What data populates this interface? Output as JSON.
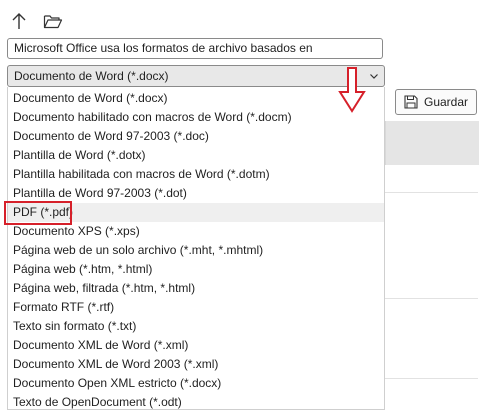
{
  "toolbar": {
    "up_icon": "arrow-up-icon",
    "folder_icon": "folder-open-icon"
  },
  "filename": {
    "value": "Microsoft Office usa los formatos de archivo basados en"
  },
  "file_type": {
    "selected": "Documento de Word (*.docx)",
    "options": [
      "Documento de Word (*.docx)",
      "Documento habilitado con macros de Word (*.docm)",
      "Documento de Word 97-2003 (*.doc)",
      "Plantilla de Word (*.dotx)",
      "Plantilla habilitada con macros de Word (*.dotm)",
      "Plantilla de Word 97-2003 (*.dot)",
      "PDF (*.pdf)",
      "Documento XPS (*.xps)",
      "Página web de un solo archivo (*.mht, *.mhtml)",
      "Página web (*.htm, *.html)",
      "Página web, filtrada (*.htm, *.html)",
      "Formato RTF (*.rtf)",
      "Texto sin formato (*.txt)",
      "Documento XML de Word (*.xml)",
      "Documento XML de Word 2003 (*.xml)",
      "Documento Open XML estricto (*.docx)",
      "Texto de OpenDocument (*.odt)"
    ],
    "highlighted_option": "PDF (*.pdf)"
  },
  "save_button": {
    "label": "Guardar",
    "icon": "save-icon"
  },
  "annotation": {
    "color": "#d6202a"
  }
}
